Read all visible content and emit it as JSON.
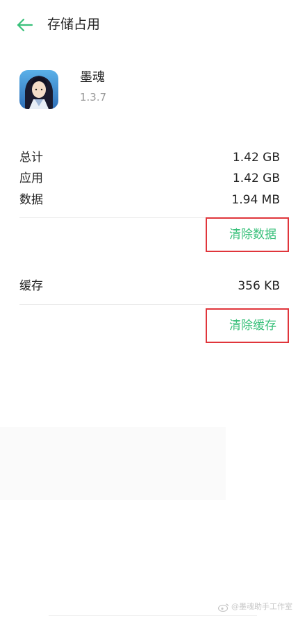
{
  "header": {
    "back_icon": "arrow-left-icon",
    "title": "存储占用",
    "accent_color": "#38c07a"
  },
  "app": {
    "icon": "app-icon-moshun",
    "name": "墨魂",
    "version": "1.3.7"
  },
  "storage": {
    "rows": [
      {
        "label": "总计",
        "value": "1.42 GB"
      },
      {
        "label": "应用",
        "value": "1.42 GB"
      },
      {
        "label": "数据",
        "value": "1.94 MB"
      }
    ],
    "clear_data_label": "清除数据"
  },
  "cache": {
    "label": "缓存",
    "value": "356 KB",
    "clear_cache_label": "清除缓存"
  },
  "watermark": {
    "icon": "weibo-icon",
    "text": "@墨魂助手工作室"
  },
  "colors": {
    "highlight_border": "#e0353b",
    "action_text": "#38c07a"
  }
}
